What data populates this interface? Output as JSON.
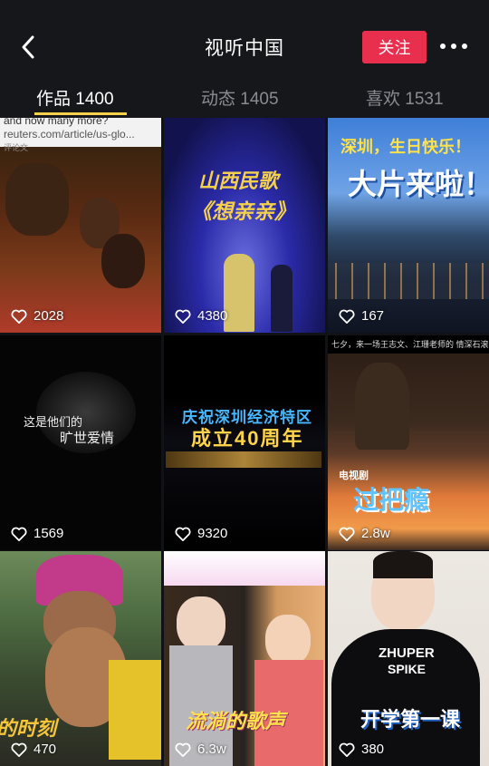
{
  "header": {
    "title": "视听中国",
    "follow_label": "关注"
  },
  "tabs": [
    {
      "label": "作品 1400"
    },
    {
      "label": "动态 1405"
    },
    {
      "label": "喜欢 1531"
    }
  ],
  "videos": [
    {
      "likes": "2028",
      "caption_lines": [
        "and now many more?",
        "reuters.com/article/us-glo...",
        "评论文"
      ]
    },
    {
      "likes": "4380",
      "caption_lines": [
        "山西民歌",
        "《想亲亲》"
      ]
    },
    {
      "likes": "167",
      "caption_lines": [
        "深圳，生日快乐！",
        "大片来啦！"
      ]
    },
    {
      "likes": "1569",
      "caption_lines": [
        "这是他们的",
        "旷世爱情"
      ]
    },
    {
      "likes": "9320",
      "caption_lines": [
        "庆祝深圳经济特区",
        "成立40周年"
      ]
    },
    {
      "likes": "2.8w",
      "caption_lines": [
        "七夕，来一场王志文、江珊老师的 情深石滚",
        "电视剧",
        "过把瘾"
      ]
    },
    {
      "likes": "470",
      "caption_lines": [
        "的时刻"
      ]
    },
    {
      "likes": "6.3w",
      "caption_lines": [
        "流淌的歌声"
      ]
    },
    {
      "likes": "380",
      "caption_lines": [
        "ZHUPER",
        "SPIKE",
        "开学第一课"
      ]
    }
  ],
  "icons": {
    "back": "chevron-left-icon",
    "more": "more-dots-icon",
    "like": "heart-outline-icon"
  },
  "colors": {
    "follow_button": "#e8304e",
    "tab_indicator": "#f7d14a"
  }
}
